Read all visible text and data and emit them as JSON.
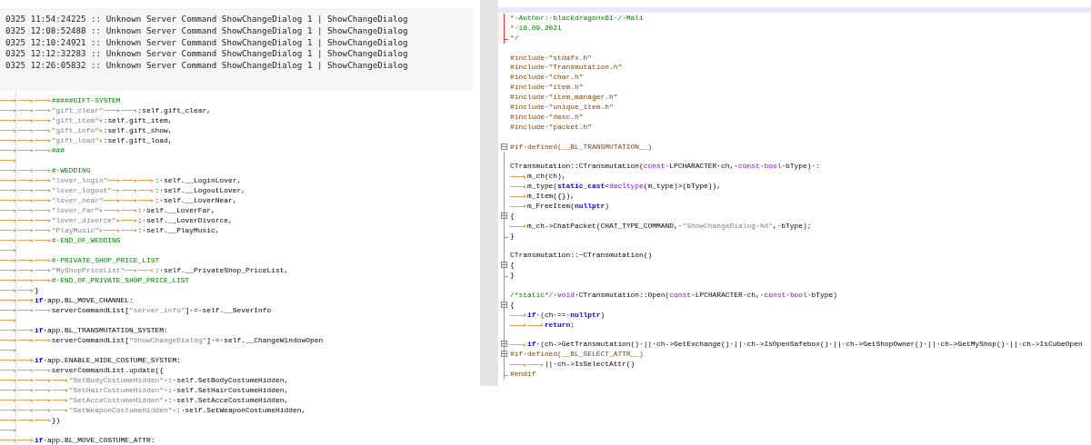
{
  "log_panel": {
    "lines": [
      "0325 11:54:24225 :: Unknown Server Command ShowChangeDialog 1 | ShowChangeDialog",
      "0325 12:08:52488 :: Unknown Server Command ShowChangeDialog 1 | ShowChangeDialog",
      "0325 12:10:24921 :: Unknown Server Command ShowChangeDialog 1 | ShowChangeDialog",
      "0325 12:12:32283 :: Unknown Server Command ShowChangeDialog 1 | ShowChangeDialog",
      "0325 12:26:05832 :: Unknown Server Command ShowChangeDialog 1 | ShowChangeDialog"
    ]
  },
  "python_editor": {
    "lines": [
      {
        "tokens": [
          {
            "kind": "tab"
          },
          {
            "kind": "tab"
          },
          {
            "kind": "tab"
          },
          {
            "kind": "comment",
            "text": "#####GIFT·SYSTEM"
          }
        ]
      },
      {
        "tokens": [
          {
            "kind": "tab"
          },
          {
            "kind": "tab"
          },
          {
            "kind": "tab"
          },
          {
            "kind": "string",
            "text": "\"gift_clear\""
          },
          {
            "kind": "tab"
          },
          {
            "kind": "tab"
          },
          {
            "kind": "plain",
            "text": ":self.gift_clear,"
          }
        ]
      },
      {
        "tokens": [
          {
            "kind": "tab"
          },
          {
            "kind": "tab"
          },
          {
            "kind": "tab"
          },
          {
            "kind": "string",
            "text": "\"gift_item\""
          },
          {
            "kind": "tab"
          },
          {
            "kind": "plain",
            "text": ":self.gift_item,"
          }
        ]
      },
      {
        "tokens": [
          {
            "kind": "tab"
          },
          {
            "kind": "tab"
          },
          {
            "kind": "tab"
          },
          {
            "kind": "string",
            "text": "\"gift_info\""
          },
          {
            "kind": "tab"
          },
          {
            "kind": "plain",
            "text": ":self.gift_show,"
          }
        ]
      },
      {
        "tokens": [
          {
            "kind": "tab"
          },
          {
            "kind": "tab"
          },
          {
            "kind": "tab"
          },
          {
            "kind": "string",
            "text": "\"gift_load\""
          },
          {
            "kind": "tab"
          },
          {
            "kind": "plain",
            "text": ":self.gift_load,"
          }
        ]
      },
      {
        "tokens": [
          {
            "kind": "tab"
          },
          {
            "kind": "tab"
          },
          {
            "kind": "tab"
          },
          {
            "kind": "comment",
            "text": "###"
          }
        ]
      },
      {
        "tokens": [
          {
            "kind": "tab"
          }
        ]
      },
      {
        "tokens": [
          {
            "kind": "tab"
          },
          {
            "kind": "tab"
          },
          {
            "kind": "tab"
          },
          {
            "kind": "comment",
            "text": "#·WEDDING"
          }
        ]
      },
      {
        "tokens": [
          {
            "kind": "tab"
          },
          {
            "kind": "tab"
          },
          {
            "kind": "tab"
          },
          {
            "kind": "string",
            "text": "\"lover_login\""
          },
          {
            "kind": "tab"
          },
          {
            "kind": "tab"
          },
          {
            "kind": "tab"
          },
          {
            "kind": "plain",
            "text": ":·self.__LoginLover,"
          }
        ]
      },
      {
        "tokens": [
          {
            "kind": "tab"
          },
          {
            "kind": "tab"
          },
          {
            "kind": "tab"
          },
          {
            "kind": "string",
            "text": "\"lover_logout\""
          },
          {
            "kind": "tab"
          },
          {
            "kind": "tab"
          },
          {
            "kind": "tab"
          },
          {
            "kind": "plain",
            "text": ":·self.__LogoutLover,"
          }
        ]
      },
      {
        "tokens": [
          {
            "kind": "tab"
          },
          {
            "kind": "tab"
          },
          {
            "kind": "tab"
          },
          {
            "kind": "string",
            "text": "\"lover_near\""
          },
          {
            "kind": "tab"
          },
          {
            "kind": "tab"
          },
          {
            "kind": "tab"
          },
          {
            "kind": "plain",
            "text": ":·self.__LoverNear,"
          }
        ]
      },
      {
        "tokens": [
          {
            "kind": "tab"
          },
          {
            "kind": "tab"
          },
          {
            "kind": "tab"
          },
          {
            "kind": "string",
            "text": "\"lover_far\""
          },
          {
            "kind": "tab"
          },
          {
            "kind": "tab"
          },
          {
            "kind": "tab"
          },
          {
            "kind": "plain",
            "text": ":·self.__LoverFar,"
          }
        ]
      },
      {
        "tokens": [
          {
            "kind": "tab"
          },
          {
            "kind": "tab"
          },
          {
            "kind": "tab"
          },
          {
            "kind": "string",
            "text": "\"lover_divorce\""
          },
          {
            "kind": "tab"
          },
          {
            "kind": "tab"
          },
          {
            "kind": "plain",
            "text": ":·self.__LoverDivorce,"
          }
        ]
      },
      {
        "tokens": [
          {
            "kind": "tab"
          },
          {
            "kind": "tab"
          },
          {
            "kind": "tab"
          },
          {
            "kind": "string",
            "text": "\"PlayMusic\""
          },
          {
            "kind": "tab"
          },
          {
            "kind": "tab"
          },
          {
            "kind": "tab"
          },
          {
            "kind": "plain",
            "text": ":·self.__PlayMusic,"
          }
        ]
      },
      {
        "tokens": [
          {
            "kind": "tab"
          },
          {
            "kind": "tab"
          },
          {
            "kind": "tab"
          },
          {
            "kind": "comment",
            "text": "#·END_OF_WEDDING"
          }
        ]
      },
      {
        "tokens": [
          {
            "kind": "tab"
          }
        ]
      },
      {
        "tokens": [
          {
            "kind": "tab"
          },
          {
            "kind": "tab"
          },
          {
            "kind": "tab"
          },
          {
            "kind": "comment",
            "text": "#·PRIVATE_SHOP_PRICE_LIST"
          }
        ]
      },
      {
        "tokens": [
          {
            "kind": "tab"
          },
          {
            "kind": "tab"
          },
          {
            "kind": "tab"
          },
          {
            "kind": "string",
            "text": "\"MyShopPriceList\""
          },
          {
            "kind": "tab"
          },
          {
            "kind": "tab"
          },
          {
            "kind": "plain",
            "text": ":·self.__PrivateShop_PriceList,"
          }
        ]
      },
      {
        "tokens": [
          {
            "kind": "tab"
          },
          {
            "kind": "tab"
          },
          {
            "kind": "tab"
          },
          {
            "kind": "comment",
            "text": "#·END_OF_PRIVATE_SHOP_PRICE_LIST"
          }
        ]
      },
      {
        "tokens": [
          {
            "kind": "tab"
          },
          {
            "kind": "tab"
          },
          {
            "kind": "plain",
            "text": "}"
          }
        ]
      },
      {
        "tokens": [
          {
            "kind": "tab"
          },
          {
            "kind": "tab"
          },
          {
            "kind": "keyword",
            "text": "if"
          },
          {
            "kind": "plain",
            "text": "·app.BL_MOVE_CHANNEL:"
          }
        ]
      },
      {
        "tokens": [
          {
            "kind": "tab"
          },
          {
            "kind": "tab"
          },
          {
            "kind": "tab"
          },
          {
            "kind": "plain",
            "text": "serverCommandList["
          },
          {
            "kind": "string",
            "text": "\"server_info\""
          },
          {
            "kind": "plain",
            "text": "]·=·self.__SeverInfo"
          }
        ]
      },
      {
        "tokens": [
          {
            "kind": "tab"
          }
        ]
      },
      {
        "tokens": [
          {
            "kind": "tab"
          },
          {
            "kind": "tab"
          },
          {
            "kind": "keyword",
            "text": "if"
          },
          {
            "kind": "plain",
            "text": "·app.BL_TRANSMUTATION_SYSTEM:"
          }
        ]
      },
      {
        "tokens": [
          {
            "kind": "tab"
          },
          {
            "kind": "tab"
          },
          {
            "kind": "tab"
          },
          {
            "kind": "plain",
            "text": "serverCommandList["
          },
          {
            "kind": "string",
            "text": "\"ShowChangeDialog\""
          },
          {
            "kind": "plain",
            "text": "]·=·self.__ChangeWindowOpen"
          }
        ]
      },
      {
        "tokens": [
          {
            "kind": "tab"
          }
        ]
      },
      {
        "tokens": [
          {
            "kind": "tab"
          },
          {
            "kind": "tab"
          },
          {
            "kind": "keyword",
            "text": "if"
          },
          {
            "kind": "plain",
            "text": "·app.ENABLE_HIDE_COSTUME_SYSTEM:"
          }
        ]
      },
      {
        "tokens": [
          {
            "kind": "tab"
          },
          {
            "kind": "tab"
          },
          {
            "kind": "tab"
          },
          {
            "kind": "plain",
            "text": "serverCommandList.update({"
          }
        ]
      },
      {
        "tokens": [
          {
            "kind": "tab"
          },
          {
            "kind": "tab"
          },
          {
            "kind": "tab"
          },
          {
            "kind": "tab"
          },
          {
            "kind": "string",
            "text": "\"SetBodyCostumeHidden\""
          },
          {
            "kind": "plain",
            "text": "·:·self.SetBodyCostumeHidden,"
          }
        ]
      },
      {
        "tokens": [
          {
            "kind": "tab"
          },
          {
            "kind": "tab"
          },
          {
            "kind": "tab"
          },
          {
            "kind": "tab"
          },
          {
            "kind": "string",
            "text": "\"SetHairCostumeHidden\""
          },
          {
            "kind": "plain",
            "text": "·:·self.SetHairCostumeHidden,"
          }
        ]
      },
      {
        "tokens": [
          {
            "kind": "tab"
          },
          {
            "kind": "tab"
          },
          {
            "kind": "tab"
          },
          {
            "kind": "tab"
          },
          {
            "kind": "string",
            "text": "\"SetAcceCostumeHidden\""
          },
          {
            "kind": "plain",
            "text": "·:·self.SetAcceCostumeHidden,"
          }
        ]
      },
      {
        "tokens": [
          {
            "kind": "tab"
          },
          {
            "kind": "tab"
          },
          {
            "kind": "tab"
          },
          {
            "kind": "tab"
          },
          {
            "kind": "string",
            "text": "\"SetWeaponCostumeHidden\""
          },
          {
            "kind": "plain",
            "text": "·:·self.SetWeaponCostumeHidden,"
          }
        ]
      },
      {
        "tokens": [
          {
            "kind": "tab"
          },
          {
            "kind": "tab"
          },
          {
            "kind": "tab"
          },
          {
            "kind": "plain",
            "text": "})"
          }
        ]
      },
      {
        "tokens": [
          {
            "kind": "tab"
          }
        ]
      },
      {
        "tokens": [
          {
            "kind": "tab"
          },
          {
            "kind": "tab"
          },
          {
            "kind": "keyword",
            "text": "if"
          },
          {
            "kind": "plain",
            "text": "·app.BL_MOVE_COSTUME_ATTR:"
          }
        ]
      }
    ]
  },
  "cpp_editor": {
    "lines": [
      {
        "in_block": true,
        "collapsible": false,
        "block_end": false,
        "highlighted": true,
        "tokens": [
          {
            "kind": "comment",
            "text": "*·Author:·blackdragonx61·/·Mali"
          }
        ]
      },
      {
        "in_block": true,
        "collapsible": false,
        "block_end": false,
        "highlighted": true,
        "tokens": [
          {
            "kind": "comment",
            "text": "*·18.09.2021"
          }
        ]
      },
      {
        "in_block": true,
        "collapsible": false,
        "block_end": true,
        "highlighted": true,
        "tokens": [
          {
            "kind": "comment",
            "text": "*/"
          }
        ]
      },
      {
        "in_block": false,
        "collapsible": false,
        "block_end": false,
        "highlighted": false
      },
      {
        "in_block": false,
        "collapsible": false,
        "block_end": false,
        "highlighted": false,
        "tokens": [
          {
            "kind": "preproc",
            "text": "#include·\"stdafx.h\""
          }
        ]
      },
      {
        "in_block": false,
        "collapsible": false,
        "block_end": false,
        "highlighted": false,
        "tokens": [
          {
            "kind": "preproc",
            "text": "#include·\"Transmutation.h\""
          }
        ]
      },
      {
        "in_block": false,
        "collapsible": false,
        "block_end": false,
        "highlighted": false,
        "tokens": [
          {
            "kind": "preproc",
            "text": "#include·\"char.h\""
          }
        ]
      },
      {
        "in_block": false,
        "collapsible": false,
        "block_end": false,
        "highlighted": false,
        "tokens": [
          {
            "kind": "preproc",
            "text": "#include·\"item.h\""
          }
        ]
      },
      {
        "in_block": false,
        "collapsible": false,
        "block_end": false,
        "highlighted": false,
        "tokens": [
          {
            "kind": "preproc",
            "text": "#include·\"item_manager.h\""
          }
        ]
      },
      {
        "in_block": false,
        "collapsible": false,
        "block_end": false,
        "highlighted": false,
        "tokens": [
          {
            "kind": "preproc",
            "text": "#include·\"unique_item.h\""
          }
        ]
      },
      {
        "in_block": false,
        "collapsible": false,
        "block_end": false,
        "highlighted": false,
        "tokens": [
          {
            "kind": "preproc",
            "text": "#include·\"desc.h\""
          }
        ]
      },
      {
        "in_block": false,
        "collapsible": false,
        "block_end": false,
        "highlighted": false,
        "tokens": [
          {
            "kind": "preproc",
            "text": "#include·\"packet.h\""
          }
        ]
      },
      {
        "in_block": false,
        "collapsible": false,
        "block_end": false,
        "highlighted": false
      },
      {
        "in_block": false,
        "collapsible": true,
        "block_end": false,
        "highlighted": false,
        "tokens": [
          {
            "kind": "preproc",
            "text": "#if·defined(__BL_TRANSMUTATION__)"
          }
        ]
      },
      {
        "in_block": true,
        "collapsible": false,
        "block_end": false,
        "highlighted": false
      },
      {
        "in_block": true,
        "collapsible": false,
        "block_end": false,
        "highlighted": false,
        "tokens": [
          {
            "kind": "plain",
            "text": "CTransmutation::CTransmutation("
          },
          {
            "kind": "type",
            "text": "const"
          },
          {
            "kind": "plain",
            "text": "·LPCHARACTER·ch,·"
          },
          {
            "kind": "type",
            "text": "const"
          },
          {
            "kind": "plain",
            "text": "·"
          },
          {
            "kind": "type",
            "text": "bool"
          },
          {
            "kind": "plain",
            "text": "·bType)·:"
          }
        ]
      },
      {
        "in_block": true,
        "collapsible": false,
        "block_end": false,
        "highlighted": false,
        "tokens": [
          {
            "kind": "tab"
          },
          {
            "kind": "plain",
            "text": "m_ch(ch),"
          }
        ]
      },
      {
        "in_block": true,
        "collapsible": false,
        "block_end": false,
        "highlighted": false,
        "tokens": [
          {
            "kind": "tab"
          },
          {
            "kind": "plain",
            "text": "m_type("
          },
          {
            "kind": "keyword",
            "text": "static_cast"
          },
          {
            "kind": "plain",
            "text": "<"
          },
          {
            "kind": "type",
            "text": "decltype"
          },
          {
            "kind": "plain",
            "text": "(m_type)>(bType)),"
          }
        ]
      },
      {
        "in_block": true,
        "collapsible": false,
        "block_end": false,
        "highlighted": false,
        "tokens": [
          {
            "kind": "tab"
          },
          {
            "kind": "plain",
            "text": "m_Item({}),"
          }
        ]
      },
      {
        "in_block": true,
        "collapsible": false,
        "block_end": false,
        "highlighted": false,
        "tokens": [
          {
            "kind": "tab"
          },
          {
            "kind": "plain",
            "text": "m_FreeItem("
          },
          {
            "kind": "keyword",
            "text": "nullptr"
          },
          {
            "kind": "plain",
            "text": ")"
          }
        ]
      },
      {
        "in_block": true,
        "collapsible": true,
        "block_end": false,
        "highlighted": false,
        "tokens": [
          {
            "kind": "plain",
            "text": "{"
          }
        ]
      },
      {
        "in_block": true,
        "collapsible": false,
        "block_end": false,
        "highlighted": false,
        "tokens": [
          {
            "kind": "tab"
          },
          {
            "kind": "plain",
            "text": "m_ch->ChatPacket(CHAT_TYPE_COMMAND,·"
          },
          {
            "kind": "string",
            "text": "\"ShowChangeDialog·%d\""
          },
          {
            "kind": "plain",
            "text": ",·bType);"
          }
        ]
      },
      {
        "in_block": true,
        "collapsible": false,
        "block_end": true,
        "highlighted": false,
        "tokens": [
          {
            "kind": "plain",
            "text": "}"
          }
        ]
      },
      {
        "in_block": true,
        "collapsible": false,
        "block_end": false,
        "highlighted": false
      },
      {
        "in_block": true,
        "collapsible": false,
        "block_end": false,
        "highlighted": false,
        "tokens": [
          {
            "kind": "plain",
            "text": "CTransmutation::~CTransmutation()"
          }
        ]
      },
      {
        "in_block": true,
        "collapsible": true,
        "block_end": false,
        "highlighted": false,
        "tokens": [
          {
            "kind": "plain",
            "text": "{"
          }
        ]
      },
      {
        "in_block": true,
        "collapsible": false,
        "block_end": true,
        "highlighted": false,
        "tokens": [
          {
            "kind": "plain",
            "text": "}"
          }
        ]
      },
      {
        "in_block": true,
        "collapsible": false,
        "block_end": false,
        "highlighted": false
      },
      {
        "in_block": true,
        "collapsible": false,
        "block_end": false,
        "highlighted": false,
        "tokens": [
          {
            "kind": "comment",
            "text": "/*static*/"
          },
          {
            "kind": "plain",
            "text": "·"
          },
          {
            "kind": "type",
            "text": "void"
          },
          {
            "kind": "plain",
            "text": "·CTransmutation::Open("
          },
          {
            "kind": "type",
            "text": "const"
          },
          {
            "kind": "plain",
            "text": "·LPCHARACTER·ch,·"
          },
          {
            "kind": "type",
            "text": "const"
          },
          {
            "kind": "plain",
            "text": "·"
          },
          {
            "kind": "type",
            "text": "bool"
          },
          {
            "kind": "plain",
            "text": "·bType)"
          }
        ]
      },
      {
        "in_block": true,
        "collapsible": true,
        "block_end": false,
        "highlighted": false,
        "tokens": [
          {
            "kind": "plain",
            "text": "{"
          }
        ]
      },
      {
        "in_block": true,
        "collapsible": false,
        "block_end": false,
        "highlighted": false,
        "tokens": [
          {
            "kind": "tab"
          },
          {
            "kind": "keyword",
            "text": "if"
          },
          {
            "kind": "plain",
            "text": "·(ch·==·"
          },
          {
            "kind": "keyword",
            "text": "nullptr"
          },
          {
            "kind": "plain",
            "text": ")"
          }
        ]
      },
      {
        "in_block": true,
        "collapsible": false,
        "block_end": false,
        "highlighted": false,
        "tokens": [
          {
            "kind": "tab"
          },
          {
            "kind": "tab"
          },
          {
            "kind": "keyword",
            "text": "return"
          },
          {
            "kind": "plain",
            "text": ";"
          }
        ]
      },
      {
        "in_block": true,
        "collapsible": false,
        "block_end": false,
        "highlighted": false
      },
      {
        "in_block": true,
        "collapsible": true,
        "block_end": false,
        "highlighted": false,
        "tokens": [
          {
            "kind": "tab"
          },
          {
            "kind": "keyword",
            "text": "if"
          },
          {
            "kind": "plain",
            "text": "·(ch->GetTransmutation()·||·ch->GetExchange()·||·ch->IsOpenSafebox()·||·ch->GetShopOwner()·||·ch->GetMyShop()·||·ch->IsCubeOpen"
          }
        ]
      },
      {
        "in_block": true,
        "collapsible": true,
        "block_end": false,
        "highlighted": false,
        "tokens": [
          {
            "kind": "preproc",
            "text": "#if·defined(__BL_SELECT_ATTR__)"
          }
        ]
      },
      {
        "in_block": true,
        "collapsible": false,
        "block_end": false,
        "highlighted": false,
        "tokens": [
          {
            "kind": "tab"
          },
          {
            "kind": "tab"
          },
          {
            "kind": "plain",
            "text": "||·ch->IsSelectAttr()"
          }
        ]
      },
      {
        "in_block": true,
        "collapsible": false,
        "block_end": true,
        "highlighted": false,
        "tokens": [
          {
            "kind": "preproc",
            "text": "#endif"
          }
        ]
      }
    ]
  }
}
